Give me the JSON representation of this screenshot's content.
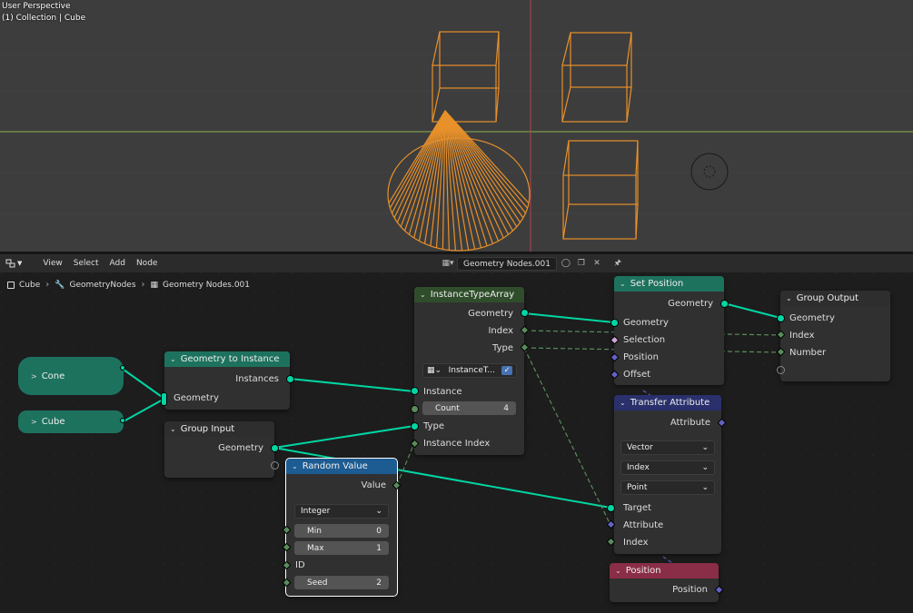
{
  "viewport": {
    "mode_label": "User Perspective",
    "collection_label": "(1) Collection | Cube"
  },
  "header": {
    "menu": [
      "View",
      "Select",
      "Add",
      "Node"
    ],
    "node_tree_name": "Geometry Nodes.001"
  },
  "breadcrumb": {
    "object": "Cube",
    "modifier": "GeometryNodes",
    "tree": "Geometry Nodes.001"
  },
  "nodes": {
    "cone": {
      "label": "Cone"
    },
    "cube": {
      "label": "Cube"
    },
    "geo_to_instance": {
      "title": "Geometry to Instance",
      "out_instances": "Instances",
      "in_geometry": "Geometry"
    },
    "group_input": {
      "title": "Group Input",
      "out_geometry": "Geometry"
    },
    "random_value": {
      "title": "Random Value",
      "out_value": "Value",
      "type": "Integer",
      "min_label": "Min",
      "min_value": "0",
      "max_label": "Max",
      "max_value": "1",
      "id_label": "ID",
      "seed_label": "Seed",
      "seed_value": "2"
    },
    "instance_array": {
      "title": "InstanceTypeArray",
      "out_geometry": "Geometry",
      "out_index": "Index",
      "out_type": "Type",
      "tree_field": "InstanceT...",
      "in_instance": "Instance",
      "count_label": "Count",
      "count_value": "4",
      "in_type": "Type",
      "in_instance_index": "Instance Index"
    },
    "set_position": {
      "title": "Set Position",
      "out_geometry": "Geometry",
      "in_geometry": "Geometry",
      "in_selection": "Selection",
      "in_position": "Position",
      "in_offset": "Offset"
    },
    "group_output": {
      "title": "Group Output",
      "in_geometry": "Geometry",
      "in_index": "Index",
      "in_number": "Number"
    },
    "transfer_attribute": {
      "title": "Transfer Attribute",
      "out_attribute": "Attribute",
      "data_type": "Vector",
      "mode": "Index",
      "domain": "Point",
      "in_target": "Target",
      "in_attribute": "Attribute",
      "in_index": "Index"
    },
    "position": {
      "title": "Position",
      "out_position": "Position"
    }
  },
  "colors": {
    "geometry_socket": "#00d6a3",
    "vector_socket": "#6363c7",
    "int_socket": "#598c5c",
    "wire_geometry": "#00d6a3",
    "wire_field": "#598c5c",
    "wireframe": "#e8902a",
    "x_axis": "#8ab34a",
    "y_axis": "#b8434c"
  }
}
